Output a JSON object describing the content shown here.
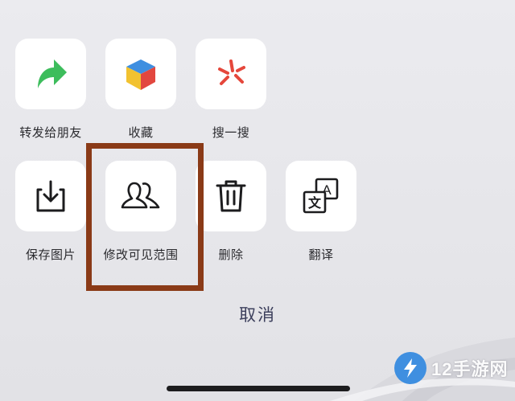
{
  "share_sheet": {
    "row1": [
      {
        "label": "转发给朋友",
        "icon": "forward-arrow-icon",
        "color": "#3dbd5c"
      },
      {
        "label": "收藏",
        "icon": "favorite-cube-icon",
        "colors": [
          "#3f8fe0",
          "#f2c230",
          "#e2473f"
        ]
      },
      {
        "label": "搜一搜",
        "icon": "search-spark-icon",
        "color": "#e5473b"
      }
    ],
    "row2": [
      {
        "label": "保存图片",
        "icon": "save-download-icon"
      },
      {
        "label": "修改可见范围",
        "icon": "visibility-users-icon"
      },
      {
        "label": "删除",
        "icon": "trash-icon"
      },
      {
        "label": "翻译",
        "icon": "translate-icon",
        "glyph_a": "A",
        "glyph_b": "文"
      }
    ],
    "cancel_label": "取消"
  },
  "highlight": {
    "target": "修改可见范围",
    "color": "#8a3a17"
  },
  "watermark": {
    "text": "12手游网",
    "icon": "lightning-logo-icon"
  }
}
